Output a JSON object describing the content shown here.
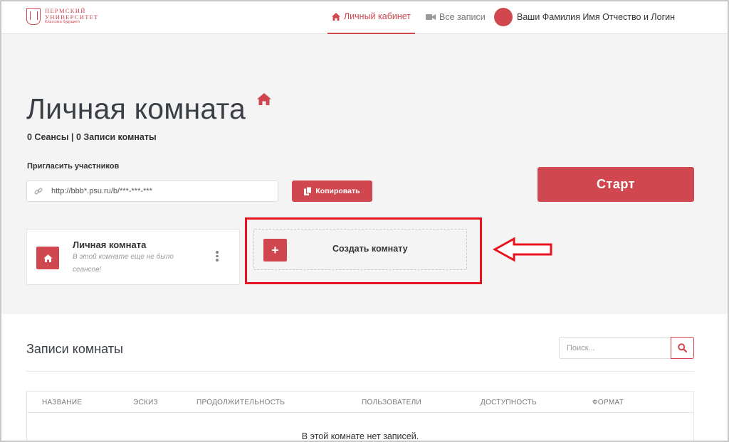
{
  "brand": {
    "line1": "ПЕРМСКИЙ",
    "line2": "УНИВЕРСИТЕТ",
    "line3": "Классика будущего",
    "color": "#d0474f"
  },
  "nav": {
    "cabinet": "Личный кабинет",
    "cabinet_icon": "home-icon",
    "records": "Все записи",
    "records_icon": "video-camera-icon",
    "user": "Ваши Фамилия Имя Отчество и Логин"
  },
  "room": {
    "title": "Личная комната",
    "stats_sessions": "0 Сеансы",
    "stats_sep": " | ",
    "stats_records": "0 Записи комнаты",
    "invite_label": "Пригласить участников",
    "invite_url": "http://bbb*.psu.ru/b/***-***-***",
    "copy_label": "Копировать",
    "start_label": "Старт"
  },
  "cards": {
    "room_name": "Личная комната",
    "room_desc": "В этой комнате еще не было сеансов!",
    "create_label": "Создать комнату",
    "create_symbol": "+"
  },
  "records": {
    "title": "Записи комнаты",
    "search_placeholder": "Поиск...",
    "columns": [
      "НАЗВАНИЕ",
      "ЭСКИЗ",
      "ПРОДОЛЖИТЕЛЬНОСТЬ",
      "ПОЛЬЗОВАТЕЛИ",
      "ДОСТУПНОСТЬ",
      "ФОРМАТ"
    ],
    "empty": "В этой комнате нет записей."
  },
  "colors": {
    "accent": "#d0474f",
    "highlight": "#e8131f",
    "hero_bg": "#f4f4f5"
  }
}
